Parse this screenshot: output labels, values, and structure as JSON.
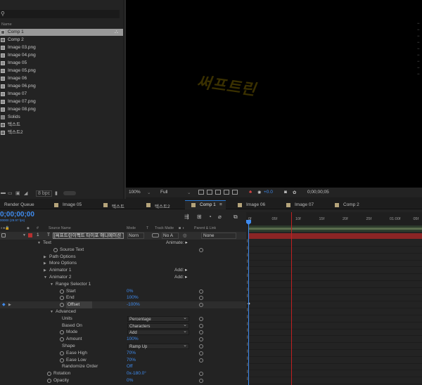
{
  "project": {
    "name_header": "Name",
    "items": [
      {
        "label": "Comp 1",
        "type": "comp",
        "selected": true
      },
      {
        "label": "Comp 2",
        "type": "comp"
      },
      {
        "label": "Image 03.png",
        "type": "image"
      },
      {
        "label": "Image 04.png",
        "type": "image"
      },
      {
        "label": "Image 05",
        "type": "image"
      },
      {
        "label": "Image 05.png",
        "type": "image"
      },
      {
        "label": "Image 06",
        "type": "image"
      },
      {
        "label": "Image 06.png",
        "type": "image"
      },
      {
        "label": "Image 07",
        "type": "image"
      },
      {
        "label": "Image 07.png",
        "type": "image"
      },
      {
        "label": "Image 08.png",
        "type": "image"
      },
      {
        "label": "Solids",
        "type": "folder"
      },
      {
        "label": "텍스트",
        "type": "comp"
      },
      {
        "label": "텍스트2",
        "type": "comp"
      }
    ],
    "bpc": "8 bpc"
  },
  "viewer": {
    "watermark": "써프트린",
    "zoom": "100%",
    "resolution": "Full",
    "exposure": "+0.0",
    "timecode": "0;00;00;05"
  },
  "tabs": [
    {
      "label": "Render Queue"
    },
    {
      "label": "Image 05"
    },
    {
      "label": "텍스트"
    },
    {
      "label": "텍스트2"
    },
    {
      "label": "Comp 1",
      "active": true
    },
    {
      "label": "Image 06"
    },
    {
      "label": "Image 07"
    },
    {
      "label": "Comp 2"
    }
  ],
  "timeline": {
    "timecode": "0;00;00;00",
    "fps": "00000 (29.97 fps)",
    "columns": {
      "source_name": "Source Name",
      "mode": "Mode",
      "t": "T",
      "track_matte": "Track Matte",
      "parent": "Parent & Link"
    },
    "layer": {
      "number": "1",
      "type_icon": "T",
      "name": "[써프트린이펙트 타이포 애니메이션 7",
      "mode": "Norn",
      "matte": "No A",
      "parent": "None",
      "label_color": "#b83030"
    },
    "props": [
      {
        "label": "Text",
        "indent": 1,
        "open": true,
        "right": "Animate:"
      },
      {
        "label": "Source Text",
        "indent": 3,
        "stopwatch": true
      },
      {
        "label": "Path Options",
        "indent": 2,
        "closed": true
      },
      {
        "label": "More Options",
        "indent": 2,
        "closed": true
      },
      {
        "label": "Animator 1",
        "indent": 2,
        "closed": true,
        "right": "Add:"
      },
      {
        "label": "Animator 2",
        "indent": 2,
        "open": true,
        "right": "Add:"
      },
      {
        "label": "Range Selector 1",
        "indent": 3,
        "open": true
      },
      {
        "label": "Start",
        "indent": 4,
        "stopwatch": true,
        "value": "0%"
      },
      {
        "label": "End",
        "indent": 4,
        "stopwatch": true,
        "value": "100%"
      },
      {
        "label": "Offset",
        "indent": 4,
        "stopwatch": true,
        "value": "-100%",
        "highlight": true
      },
      {
        "label": "Advanced",
        "indent": 3,
        "open": true
      },
      {
        "label": "Units",
        "indent": 4,
        "dropdown": "Percentage"
      },
      {
        "label": "Based On",
        "indent": 4,
        "dropdown": "Characters"
      },
      {
        "label": "Mode",
        "indent": 4,
        "stopwatch": true,
        "dropdown": "Add"
      },
      {
        "label": "Amount",
        "indent": 4,
        "stopwatch": true,
        "value": "100%"
      },
      {
        "label": "Shape",
        "indent": 4,
        "dropdown": "Ramp Up"
      },
      {
        "label": "Ease High",
        "indent": 4,
        "stopwatch": true,
        "value": "70%"
      },
      {
        "label": "Ease Low",
        "indent": 4,
        "stopwatch": true,
        "value": "70%"
      },
      {
        "label": "Randomize Order",
        "indent": 4,
        "value": "Off"
      },
      {
        "label": "Rotation",
        "indent": 2,
        "stopwatch": true,
        "value": "0x-180.0°"
      },
      {
        "label": "Opacity",
        "indent": 2,
        "stopwatch": true,
        "value": "0%"
      }
    ],
    "ruler": [
      "0f",
      "05f",
      "10f",
      "15f",
      "20f",
      "25f",
      "01:00f",
      "05f"
    ],
    "playhead_frame": 10
  }
}
